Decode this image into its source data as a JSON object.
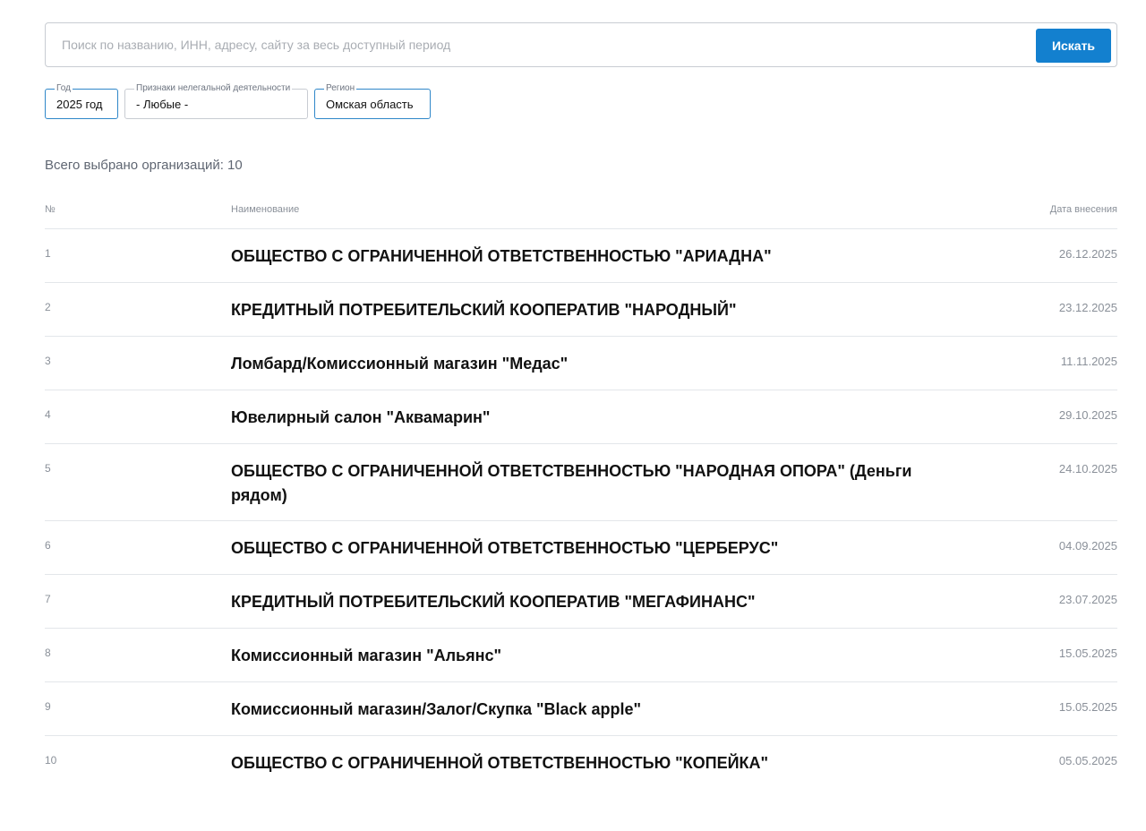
{
  "search": {
    "placeholder": "Поиск по названию, ИНН, адресу, сайту за весь доступный период",
    "button_label": "Искать"
  },
  "filters": {
    "year": {
      "legend": "Год",
      "value": "2025 год"
    },
    "signs": {
      "legend": "Признаки нелегальной деятельности",
      "value": "- Любые -"
    },
    "region": {
      "legend": "Регион",
      "value": "Омская область"
    }
  },
  "summary": {
    "total_text": "Всего выбрано организаций: 10"
  },
  "table": {
    "headers": {
      "num": "№",
      "name": "Наименование",
      "date": "Дата внесения"
    },
    "rows": [
      {
        "num": "1",
        "name": "ОБЩЕСТВО С ОГРАНИЧЕННОЙ ОТВЕТСТВЕННОСТЬЮ \"АРИАДНА\"",
        "date": "26.12.2025"
      },
      {
        "num": "2",
        "name": "КРЕДИТНЫЙ ПОТРЕБИТЕЛЬСКИЙ КООПЕРАТИВ \"НАРОДНЫЙ\"",
        "date": "23.12.2025"
      },
      {
        "num": "3",
        "name": "Ломбард/Комиссионный магазин \"Медас\"",
        "date": "11.11.2025"
      },
      {
        "num": "4",
        "name": "Ювелирный салон \"Аквамарин\"",
        "date": "29.10.2025"
      },
      {
        "num": "5",
        "name": "ОБЩЕСТВО С ОГРАНИЧЕННОЙ ОТВЕТСТВЕННОСТЬЮ \"НАРОДНАЯ ОПОРА\" (Деньги рядом)",
        "date": "24.10.2025"
      },
      {
        "num": "6",
        "name": "ОБЩЕСТВО С ОГРАНИЧЕННОЙ ОТВЕТСТВЕННОСТЬЮ \"ЦЕРБЕРУС\"",
        "date": "04.09.2025"
      },
      {
        "num": "7",
        "name": "КРЕДИТНЫЙ ПОТРЕБИТЕЛЬСКИЙ КООПЕРАТИВ \"МЕГАФИНАНС\"",
        "date": "23.07.2025"
      },
      {
        "num": "8",
        "name": "Комиссионный магазин \"Альянс\"",
        "date": "15.05.2025"
      },
      {
        "num": "9",
        "name": "Комиссионный магазин/Залог/Скупка \"Black apple\"",
        "date": "15.05.2025"
      },
      {
        "num": "10",
        "name": "ОБЩЕСТВО С ОГРАНИЧЕННОЙ ОТВЕТСТВЕННОСТЬЮ \"КОПЕЙКА\"",
        "date": "05.05.2025"
      }
    ]
  },
  "colors": {
    "accent": "#1380cf",
    "border_active": "#2f87c9",
    "muted_text": "#8a9099"
  }
}
